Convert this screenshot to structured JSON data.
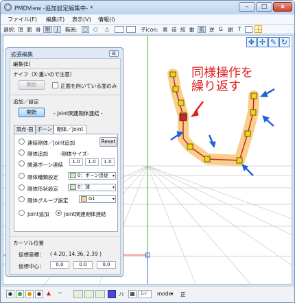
{
  "window": {
    "title": "PMDView -追加設定編集中- *",
    "min": "–",
    "max": "□",
    "close": "x"
  },
  "menu": [
    "ファイル(F)",
    "編集(E)",
    "表示(V)",
    "情報(I)"
  ],
  "toolbar": {
    "sel_label": "選択:",
    "sel_items": [
      "頂",
      "面",
      "骨",
      "剛",
      "J"
    ],
    "range_label": "範囲:",
    "range_items": [
      "□",
      "○",
      "△"
    ],
    "sub_label": "子icon:",
    "mode_items": [
      "表",
      "道",
      "絞",
      "動",
      "拡",
      "逆",
      "G",
      "謝",
      "T"
    ]
  },
  "annotation": {
    "line1": "同様操作を",
    "line2": "繰り返す"
  },
  "panel": {
    "title": "拡張編集",
    "menu": "編集(E)",
    "knife_label": "ナイフ（X:重いので注意）",
    "open_btn": "開始",
    "front_only": "正面を向いている面のみ",
    "add_label": "追加／設定",
    "start_btn": "開始",
    "mode_text": "- Joint関連剛体連結 -",
    "tabs": [
      "頂点-面",
      "ボーン",
      "剛体／Joint"
    ],
    "opts": {
      "o1": "連結剛体／Joint追加",
      "o2": "剛体追加",
      "size_label": "-剛体サイズ-",
      "reset": "Reset",
      "o3": "関連ボーン連結",
      "size": [
        "1.0",
        "1.0",
        "1.0"
      ],
      "o4": "剛体種類設定",
      "o4v": "0：ボーン追従",
      "o5": "剛体形状設定",
      "o5v": "0：球",
      "o6": "剛体グループ設定",
      "o6v": "G1",
      "o7": "Joint追加",
      "o8": "Joint関連剛体連結"
    },
    "cursor_label": "カーソル位置",
    "virt_coord_label": "仮想座標：",
    "virt_coord_value": "( 4.20, 14.36, 2.39 )",
    "virt_center_label": "仮想中心：",
    "virt_center": [
      "0.0",
      "0.0",
      "0.0"
    ]
  },
  "statusbar": {
    "mode_label": "mode",
    "mode_value": "正",
    "edge_label": "ｴｯｼﾞ",
    "note": "ﾉﾐ"
  },
  "colors": {
    "rigid_orange": "#f5a623",
    "joint_yellow": "#f2d21b",
    "bone_red": "#c0282b",
    "arrow_blue": "#1f63d8",
    "annot_red": "#e02020"
  }
}
